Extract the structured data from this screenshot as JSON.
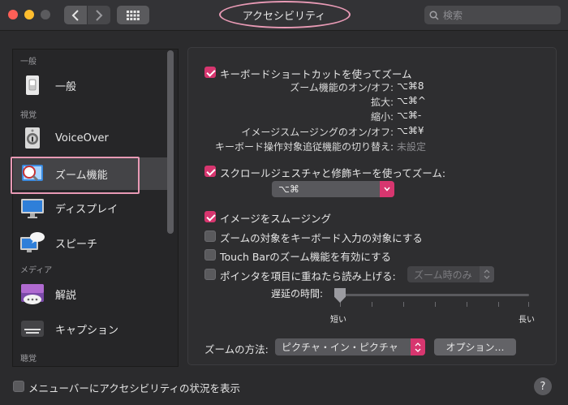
{
  "window": {
    "title": "アクセシビリティ"
  },
  "search": {
    "placeholder": "検索"
  },
  "sidebar": {
    "sections": [
      "一般",
      "視覚",
      "メディア",
      "聴覚"
    ],
    "items": [
      {
        "label": "一般",
        "icon": "general-switch-icon"
      },
      {
        "label": "VoiceOver",
        "icon": "voiceover-icon"
      },
      {
        "label": "ズーム機能",
        "icon": "zoom-magnifier-icon"
      },
      {
        "label": "ディスプレイ",
        "icon": "display-monitor-icon"
      },
      {
        "label": "スピーチ",
        "icon": "speech-bubble-icon"
      },
      {
        "label": "解説",
        "icon": "descriptions-icon"
      },
      {
        "label": "キャプション",
        "icon": "captions-icon"
      }
    ]
  },
  "main": {
    "keyboard_shortcuts": {
      "label": "キーボードショートカットを使ってズーム",
      "checked": true
    },
    "shortcuts": [
      {
        "label": "ズーム機能のオン/オフ:",
        "value": "⌥⌘8"
      },
      {
        "label": "拡大:",
        "value": "⌥⌘^"
      },
      {
        "label": "縮小:",
        "value": "⌥⌘-"
      },
      {
        "label": "イメージスムージングのオン/オフ:",
        "value": "⌥⌘¥"
      },
      {
        "label": "キーボード操作対象追従機能の切り替え:",
        "value": "未設定"
      }
    ],
    "scroll_gesture": {
      "label": "スクロールジェスチャと修飾キーを使ってズーム:",
      "checked": true,
      "modifier": "⌥⌘"
    },
    "smooth_images": {
      "label": "イメージをスムージング",
      "checked": true
    },
    "follow_keyboard": {
      "label": "ズームの対象をキーボード入力の対象にする",
      "checked": false
    },
    "touch_bar": {
      "label": "Touch Barのズーム機能を有効にする",
      "checked": false
    },
    "speak_items": {
      "label": "ポインタを項目に重ねたら読み上げる:",
      "checked": false,
      "when": "ズーム時のみ"
    },
    "delay": {
      "label": "遅延の時間:",
      "min_label": "短い",
      "max_label": "長い",
      "value": 0
    },
    "zoom_style": {
      "label": "ズームの方法:",
      "value": "ピクチャ・イン・ピクチャ"
    },
    "options_button": "オプション…"
  },
  "footer": {
    "menubar_status": {
      "label": "メニューバーにアクセシビリティの状況を表示",
      "checked": false
    },
    "help": "?"
  },
  "colors": {
    "accent": "#d7366f",
    "annotation": "#e89ab5"
  }
}
